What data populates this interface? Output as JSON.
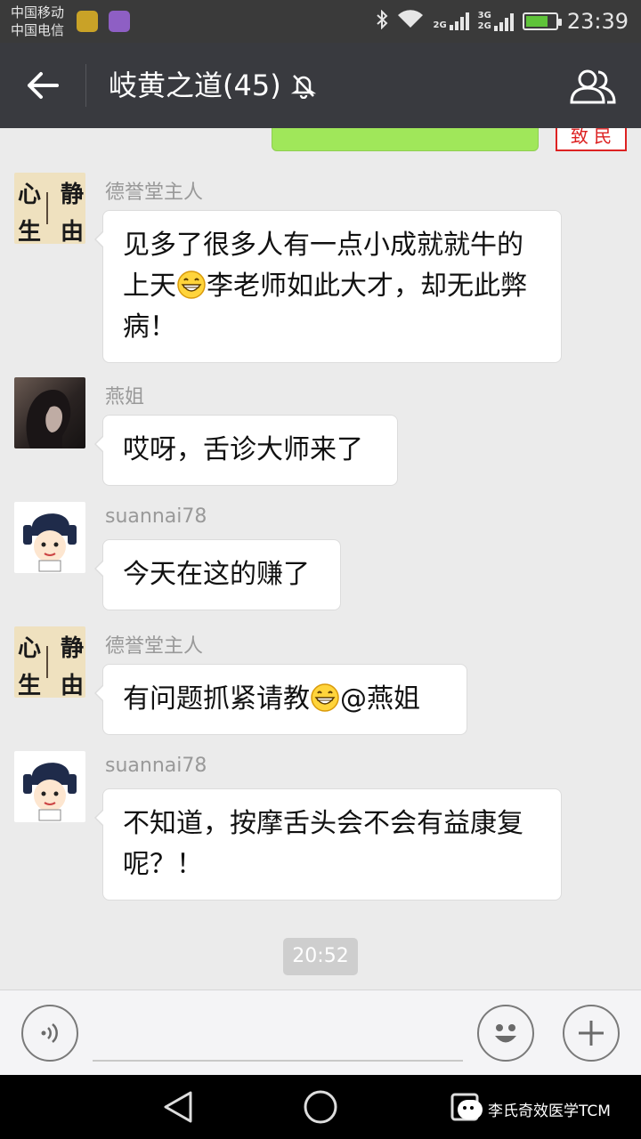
{
  "status_bar": {
    "carrier_1": "中国移动",
    "carrier_2": "中国电信",
    "network_1": "2G",
    "network_2": "3G",
    "network_3": "2G",
    "time": "23:39",
    "battery_level": 0.75,
    "battery_color": "#5fc33a"
  },
  "header": {
    "title": "岐黄之道(45)",
    "back_icon": "arrow-left-icon",
    "mute_icon": "bell-muted-icon",
    "members_icon": "group-members-icon",
    "background": "#393a3f"
  },
  "partial_top": {
    "stamp_text": "致 民"
  },
  "messages": [
    {
      "sender": "德誉堂主人",
      "avatar": "calligraphy-avatar",
      "parts": [
        "见多了很多人有一点小成就就牛的上天",
        "李老师如此大才，却无此弊病！"
      ],
      "emoji": "grin-emoji"
    },
    {
      "sender": "燕姐",
      "avatar": "photo-avatar",
      "text": "哎呀，舌诊大师来了"
    },
    {
      "sender": "suannai78",
      "avatar": "cartoon-avatar",
      "text": "今天在这的赚了"
    },
    {
      "sender": "德誉堂主人",
      "avatar": "calligraphy-avatar",
      "parts": [
        "有问题抓紧请教",
        "@燕姐"
      ],
      "emoji": "grin-emoji"
    },
    {
      "sender": "suannai78",
      "avatar": "cartoon-avatar",
      "text": "不知道，按摩舌头会不会有益康复呢？！"
    }
  ],
  "calligraphy_chars": [
    "心",
    "静",
    "生",
    "由"
  ],
  "timestamp": "20:52",
  "input_bar": {
    "voice_icon": "voice-input-icon",
    "emoji_icon": "smiley-icon",
    "plus_icon": "plus-icon",
    "value": ""
  },
  "nav_bar": {
    "watermark_text": "李氏奇效医学TCM"
  },
  "colors": {
    "chat_bg": "#ebebeb",
    "own_bubble": "#a0e75a",
    "bubble_bg": "#ffffff",
    "sender_name": "#999999"
  }
}
